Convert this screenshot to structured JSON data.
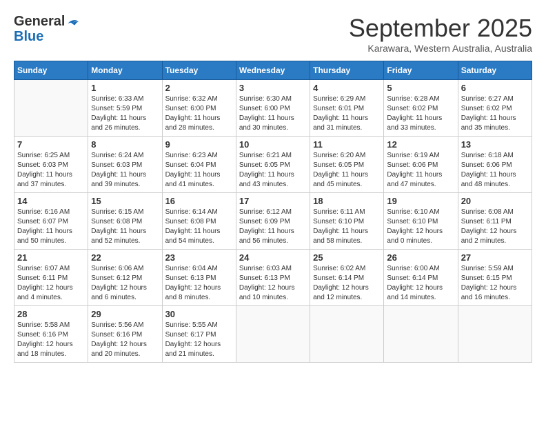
{
  "header": {
    "logo_general": "General",
    "logo_blue": "Blue",
    "month": "September 2025",
    "location": "Karawara, Western Australia, Australia"
  },
  "days_of_week": [
    "Sunday",
    "Monday",
    "Tuesday",
    "Wednesday",
    "Thursday",
    "Friday",
    "Saturday"
  ],
  "weeks": [
    [
      {
        "day": "",
        "info": ""
      },
      {
        "day": "1",
        "info": "Sunrise: 6:33 AM\nSunset: 5:59 PM\nDaylight: 11 hours\nand 26 minutes."
      },
      {
        "day": "2",
        "info": "Sunrise: 6:32 AM\nSunset: 6:00 PM\nDaylight: 11 hours\nand 28 minutes."
      },
      {
        "day": "3",
        "info": "Sunrise: 6:30 AM\nSunset: 6:00 PM\nDaylight: 11 hours\nand 30 minutes."
      },
      {
        "day": "4",
        "info": "Sunrise: 6:29 AM\nSunset: 6:01 PM\nDaylight: 11 hours\nand 31 minutes."
      },
      {
        "day": "5",
        "info": "Sunrise: 6:28 AM\nSunset: 6:02 PM\nDaylight: 11 hours\nand 33 minutes."
      },
      {
        "day": "6",
        "info": "Sunrise: 6:27 AM\nSunset: 6:02 PM\nDaylight: 11 hours\nand 35 minutes."
      }
    ],
    [
      {
        "day": "7",
        "info": "Sunrise: 6:25 AM\nSunset: 6:03 PM\nDaylight: 11 hours\nand 37 minutes."
      },
      {
        "day": "8",
        "info": "Sunrise: 6:24 AM\nSunset: 6:03 PM\nDaylight: 11 hours\nand 39 minutes."
      },
      {
        "day": "9",
        "info": "Sunrise: 6:23 AM\nSunset: 6:04 PM\nDaylight: 11 hours\nand 41 minutes."
      },
      {
        "day": "10",
        "info": "Sunrise: 6:21 AM\nSunset: 6:05 PM\nDaylight: 11 hours\nand 43 minutes."
      },
      {
        "day": "11",
        "info": "Sunrise: 6:20 AM\nSunset: 6:05 PM\nDaylight: 11 hours\nand 45 minutes."
      },
      {
        "day": "12",
        "info": "Sunrise: 6:19 AM\nSunset: 6:06 PM\nDaylight: 11 hours\nand 47 minutes."
      },
      {
        "day": "13",
        "info": "Sunrise: 6:18 AM\nSunset: 6:06 PM\nDaylight: 11 hours\nand 48 minutes."
      }
    ],
    [
      {
        "day": "14",
        "info": "Sunrise: 6:16 AM\nSunset: 6:07 PM\nDaylight: 11 hours\nand 50 minutes."
      },
      {
        "day": "15",
        "info": "Sunrise: 6:15 AM\nSunset: 6:08 PM\nDaylight: 11 hours\nand 52 minutes."
      },
      {
        "day": "16",
        "info": "Sunrise: 6:14 AM\nSunset: 6:08 PM\nDaylight: 11 hours\nand 54 minutes."
      },
      {
        "day": "17",
        "info": "Sunrise: 6:12 AM\nSunset: 6:09 PM\nDaylight: 11 hours\nand 56 minutes."
      },
      {
        "day": "18",
        "info": "Sunrise: 6:11 AM\nSunset: 6:10 PM\nDaylight: 11 hours\nand 58 minutes."
      },
      {
        "day": "19",
        "info": "Sunrise: 6:10 AM\nSunset: 6:10 PM\nDaylight: 12 hours\nand 0 minutes."
      },
      {
        "day": "20",
        "info": "Sunrise: 6:08 AM\nSunset: 6:11 PM\nDaylight: 12 hours\nand 2 minutes."
      }
    ],
    [
      {
        "day": "21",
        "info": "Sunrise: 6:07 AM\nSunset: 6:11 PM\nDaylight: 12 hours\nand 4 minutes."
      },
      {
        "day": "22",
        "info": "Sunrise: 6:06 AM\nSunset: 6:12 PM\nDaylight: 12 hours\nand 6 minutes."
      },
      {
        "day": "23",
        "info": "Sunrise: 6:04 AM\nSunset: 6:13 PM\nDaylight: 12 hours\nand 8 minutes."
      },
      {
        "day": "24",
        "info": "Sunrise: 6:03 AM\nSunset: 6:13 PM\nDaylight: 12 hours\nand 10 minutes."
      },
      {
        "day": "25",
        "info": "Sunrise: 6:02 AM\nSunset: 6:14 PM\nDaylight: 12 hours\nand 12 minutes."
      },
      {
        "day": "26",
        "info": "Sunrise: 6:00 AM\nSunset: 6:14 PM\nDaylight: 12 hours\nand 14 minutes."
      },
      {
        "day": "27",
        "info": "Sunrise: 5:59 AM\nSunset: 6:15 PM\nDaylight: 12 hours\nand 16 minutes."
      }
    ],
    [
      {
        "day": "28",
        "info": "Sunrise: 5:58 AM\nSunset: 6:16 PM\nDaylight: 12 hours\nand 18 minutes."
      },
      {
        "day": "29",
        "info": "Sunrise: 5:56 AM\nSunset: 6:16 PM\nDaylight: 12 hours\nand 20 minutes."
      },
      {
        "day": "30",
        "info": "Sunrise: 5:55 AM\nSunset: 6:17 PM\nDaylight: 12 hours\nand 21 minutes."
      },
      {
        "day": "",
        "info": ""
      },
      {
        "day": "",
        "info": ""
      },
      {
        "day": "",
        "info": ""
      },
      {
        "day": "",
        "info": ""
      }
    ]
  ]
}
